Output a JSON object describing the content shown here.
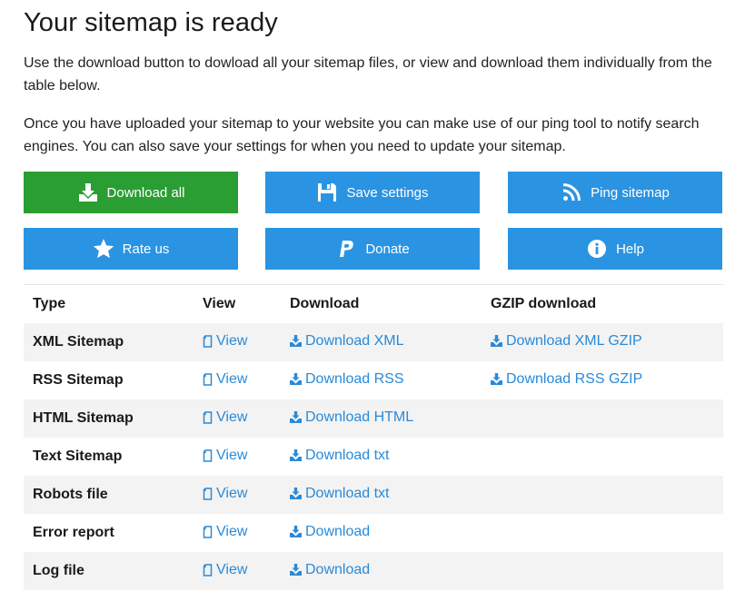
{
  "page": {
    "title": "Your sitemap is ready",
    "intro_1": "Use the download button to dowload all your sitemap files, or view and download them individually from the table below.",
    "intro_2": "Once you have uploaded your sitemap to your website you can make use of our ping tool to notify search engines. You can also save your settings for when you need to update your sitemap."
  },
  "buttons": {
    "download_all": "Download all",
    "save_settings": "Save settings",
    "ping_sitemap": "Ping sitemap",
    "rate_us": "Rate us",
    "donate": "Donate",
    "help": "Help"
  },
  "colors": {
    "primary": "#2a94e3",
    "success": "#2b9e33",
    "link": "#2a8ad8"
  },
  "table": {
    "headers": [
      "Type",
      "View",
      "Download",
      "GZIP download"
    ],
    "rows": [
      {
        "type": "XML Sitemap",
        "view": "View",
        "download": "Download XML",
        "gzip": "Download XML GZIP"
      },
      {
        "type": "RSS Sitemap",
        "view": "View",
        "download": "Download RSS",
        "gzip": "Download RSS GZIP"
      },
      {
        "type": "HTML Sitemap",
        "view": "View",
        "download": "Download HTML",
        "gzip": ""
      },
      {
        "type": "Text Sitemap",
        "view": "View",
        "download": "Download txt",
        "gzip": ""
      },
      {
        "type": "Robots file",
        "view": "View",
        "download": "Download txt",
        "gzip": ""
      },
      {
        "type": "Error report",
        "view": "View",
        "download": "Download",
        "gzip": ""
      },
      {
        "type": "Log file",
        "view": "View",
        "download": "Download",
        "gzip": ""
      }
    ]
  }
}
